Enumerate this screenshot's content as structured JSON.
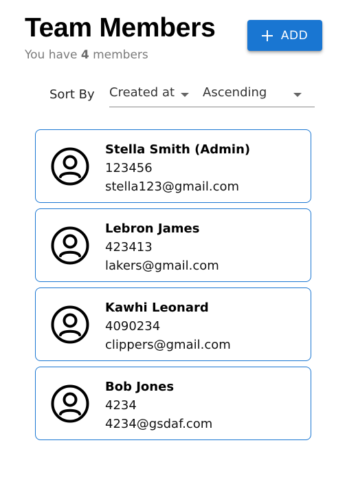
{
  "header": {
    "title": "Team Members",
    "subtitle_prefix": "You have",
    "member_count": "4",
    "subtitle_suffix": "members",
    "add_button_label": "ADD"
  },
  "sort": {
    "label": "Sort By",
    "field_value": "Created at",
    "order_value": "Ascending"
  },
  "members": [
    {
      "name": "Stella Smith (Admin)",
      "phone": "123456",
      "email": "stella123@gmail.com"
    },
    {
      "name": "Lebron James",
      "phone": "423413",
      "email": "lakers@gmail.com"
    },
    {
      "name": "Kawhi Leonard",
      "phone": "4090234",
      "email": "clippers@gmail.com"
    },
    {
      "name": "Bob Jones",
      "phone": "4234",
      "email": "4234@gsdaf.com"
    }
  ],
  "colors": {
    "accent": "#1976d2",
    "subtitle_text": "#7a7a7a"
  },
  "icons": {
    "add": "plus-icon",
    "sort_caret": "chevron-down-icon",
    "avatar": "account-circle-icon"
  }
}
